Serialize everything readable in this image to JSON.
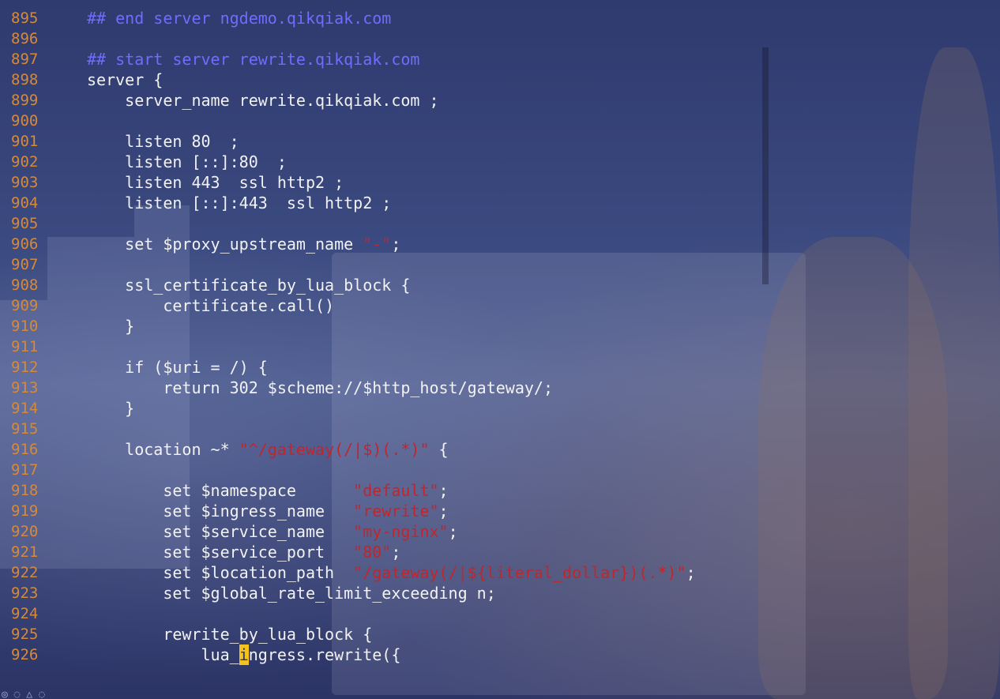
{
  "editor": {
    "lines": [
      {
        "n": "895",
        "indent": "",
        "parts": [
          {
            "t": "## end server ngdemo.qikqiak.com",
            "c": "comment"
          }
        ]
      },
      {
        "n": "896",
        "indent": "",
        "parts": []
      },
      {
        "n": "897",
        "indent": "",
        "parts": [
          {
            "t": "## start server rewrite.qikqiak.com",
            "c": "comment"
          }
        ]
      },
      {
        "n": "898",
        "indent": "",
        "parts": [
          {
            "t": "server {",
            "c": "plain"
          }
        ]
      },
      {
        "n": "899",
        "indent": "    ",
        "parts": [
          {
            "t": "server_name rewrite.qikqiak.com ;",
            "c": "plain"
          }
        ]
      },
      {
        "n": "900",
        "indent": "",
        "parts": []
      },
      {
        "n": "901",
        "indent": "    ",
        "parts": [
          {
            "t": "listen 80  ;",
            "c": "plain"
          }
        ]
      },
      {
        "n": "902",
        "indent": "    ",
        "parts": [
          {
            "t": "listen [::]:80  ;",
            "c": "plain"
          }
        ]
      },
      {
        "n": "903",
        "indent": "    ",
        "parts": [
          {
            "t": "listen 443  ssl http2 ;",
            "c": "plain"
          }
        ]
      },
      {
        "n": "904",
        "indent": "    ",
        "parts": [
          {
            "t": "listen [::]:443  ssl http2 ;",
            "c": "plain"
          }
        ]
      },
      {
        "n": "905",
        "indent": "",
        "parts": []
      },
      {
        "n": "906",
        "indent": "    ",
        "parts": [
          {
            "t": "set $proxy_upstream_name ",
            "c": "plain"
          },
          {
            "t": "\"-\"",
            "c": "str"
          },
          {
            "t": ";",
            "c": "plain"
          }
        ]
      },
      {
        "n": "907",
        "indent": "",
        "parts": []
      },
      {
        "n": "908",
        "indent": "    ",
        "parts": [
          {
            "t": "ssl_certificate_by_lua_block {",
            "c": "plain"
          }
        ]
      },
      {
        "n": "909",
        "indent": "        ",
        "parts": [
          {
            "t": "certificate.call()",
            "c": "plain"
          }
        ]
      },
      {
        "n": "910",
        "indent": "    ",
        "parts": [
          {
            "t": "}",
            "c": "plain"
          }
        ]
      },
      {
        "n": "911",
        "indent": "",
        "parts": []
      },
      {
        "n": "912",
        "indent": "    ",
        "parts": [
          {
            "t": "if ($uri = /) {",
            "c": "plain"
          }
        ]
      },
      {
        "n": "913",
        "indent": "        ",
        "parts": [
          {
            "t": "return 302 $scheme://$http_host/gateway/;",
            "c": "plain"
          }
        ]
      },
      {
        "n": "914",
        "indent": "    ",
        "parts": [
          {
            "t": "}",
            "c": "plain"
          }
        ]
      },
      {
        "n": "915",
        "indent": "",
        "parts": []
      },
      {
        "n": "916",
        "indent": "    ",
        "parts": [
          {
            "t": "location ~* ",
            "c": "plain"
          },
          {
            "t": "\"^/gateway(/|$)(.*)\"",
            "c": "str"
          },
          {
            "t": " {",
            "c": "plain"
          }
        ]
      },
      {
        "n": "917",
        "indent": "",
        "parts": []
      },
      {
        "n": "918",
        "indent": "        ",
        "parts": [
          {
            "t": "set $namespace      ",
            "c": "plain"
          },
          {
            "t": "\"default\"",
            "c": "str"
          },
          {
            "t": ";",
            "c": "plain"
          }
        ]
      },
      {
        "n": "919",
        "indent": "        ",
        "parts": [
          {
            "t": "set $ingress_name   ",
            "c": "plain"
          },
          {
            "t": "\"rewrite\"",
            "c": "str"
          },
          {
            "t": ";",
            "c": "plain"
          }
        ]
      },
      {
        "n": "920",
        "indent": "        ",
        "parts": [
          {
            "t": "set $service_name   ",
            "c": "plain"
          },
          {
            "t": "\"my-nginx\"",
            "c": "str"
          },
          {
            "t": ";",
            "c": "plain"
          }
        ]
      },
      {
        "n": "921",
        "indent": "        ",
        "parts": [
          {
            "t": "set $service_port   ",
            "c": "plain"
          },
          {
            "t": "\"80\"",
            "c": "str"
          },
          {
            "t": ";",
            "c": "plain"
          }
        ]
      },
      {
        "n": "922",
        "indent": "        ",
        "parts": [
          {
            "t": "set $location_path  ",
            "c": "plain"
          },
          {
            "t": "\"/gateway(/|${literal_dollar})(.*)\"",
            "c": "str"
          },
          {
            "t": ";",
            "c": "plain"
          }
        ]
      },
      {
        "n": "923",
        "indent": "        ",
        "parts": [
          {
            "t": "set $global_rate_limit_exceeding n;",
            "c": "plain"
          }
        ]
      },
      {
        "n": "924",
        "indent": "",
        "parts": []
      },
      {
        "n": "925",
        "indent": "        ",
        "parts": [
          {
            "t": "rewrite_by_lua_block {",
            "c": "plain"
          }
        ]
      },
      {
        "n": "926",
        "indent": "            ",
        "parts": [
          {
            "t": "lua_",
            "c": "plain"
          },
          {
            "t": "i",
            "c": "cursor"
          },
          {
            "t": "ngress.rewrite({",
            "c": "plain"
          }
        ]
      }
    ]
  },
  "colors": {
    "line_number": "#d48a3a",
    "comment": "#6f6cff",
    "string": "#c0262d",
    "text": "#f2f2f2",
    "cursor": "#f4c21c"
  }
}
